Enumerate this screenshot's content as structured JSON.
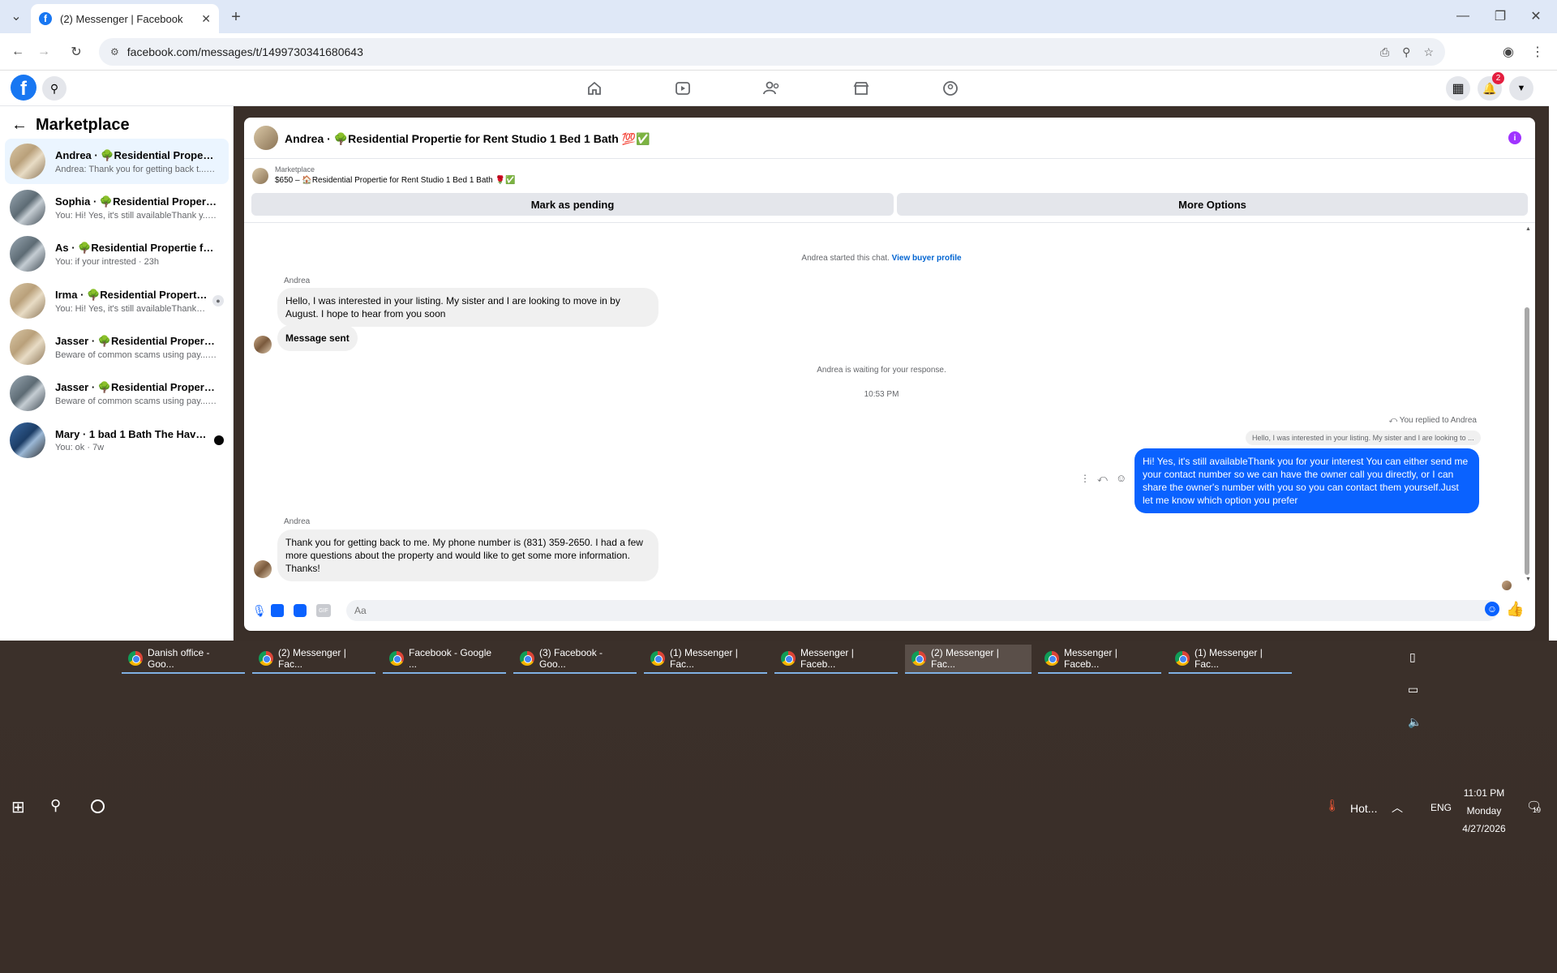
{
  "browser": {
    "tab_title": "(2) Messenger | Facebook",
    "url": "facebook.com/messages/t/1499730341680643"
  },
  "fb": {
    "notification_count": "2"
  },
  "sidebar": {
    "title": "Marketplace",
    "conversations": [
      {
        "name": "Andrea · 🌳Residential Propertie f...",
        "preview": "Andrea: Thank you for getting back t... · 1m"
      },
      {
        "name": "Sophia · 🌳Residential Propertie f...",
        "preview": "You: Hi! Yes, it's still availableThank y... · 8m"
      },
      {
        "name": "As · 🌳Residential Propertie for Re...",
        "preview": "You: if your intrested · 23h"
      },
      {
        "name": "Irma · 🌳Residential Propertie f...",
        "preview": "You: Hi! Yes, it's still availableThank... · 6w"
      },
      {
        "name": "Jasser · 🌳Residential Propertie for...",
        "preview": "Beware of common scams using pay... · 6w"
      },
      {
        "name": "Jasser · 🌳Residential Propertie for...",
        "preview": "Beware of common scams using pay... · 6w"
      },
      {
        "name": "Mary · 1 bad 1 Bath The Haven L...",
        "preview": "You: ok · 7w"
      }
    ]
  },
  "chat": {
    "header_title": "Andrea · 🌳Residential Propertie for Rent Studio 1 Bed 1 Bath 💯✅",
    "listing_source": "Marketplace",
    "listing_title": "$650 – 🏠Residential Propertie for Rent Studio 1 Bed 1 Bath 🌹✅",
    "btn_pending": "Mark as pending",
    "btn_more": "More Options",
    "started_text": "Andrea started this chat.",
    "view_profile": "View buyer profile",
    "sender_name": "Andrea",
    "msg1": "Hello, I was interested in your listing. My sister and I are looking to move in by August. I hope to hear from you soon",
    "msg2": "Message sent",
    "waiting": "Andrea is waiting for your response.",
    "time": "10:53 PM",
    "replied_to": "You replied to Andrea",
    "quoted": "Hello, I was interested in your listing. My sister and I are looking to ...",
    "reply": "Hi! Yes, it's still availableThank you for your interest You can either send me your contact number so we can have the owner call you directly, or I can share the owner's number with you so you can contact them yourself.Just let me know which option you prefer",
    "sender_name2": "Andrea",
    "msg3": "Thank you for getting back to me. My phone number is (831) 359-2650. I had a few more questions about the property and would like to get some more information. Thanks!",
    "composer_placeholder": "Aa"
  },
  "taskbar": {
    "items": [
      "Danish office - Goo...",
      "(2) Messenger | Fac...",
      "Facebook - Google ...",
      "(3) Facebook - Goo...",
      "(1) Messenger | Fac...",
      "Messenger | Faceb...",
      "(2) Messenger | Fac...",
      "Messenger | Faceb...",
      "(1) Messenger | Fac..."
    ],
    "weather": "Hot...",
    "lang": "ENG",
    "clock_time": "11:01 PM",
    "clock_day": "Monday",
    "clock_date": "4/27/2026",
    "notif_count": "19"
  }
}
